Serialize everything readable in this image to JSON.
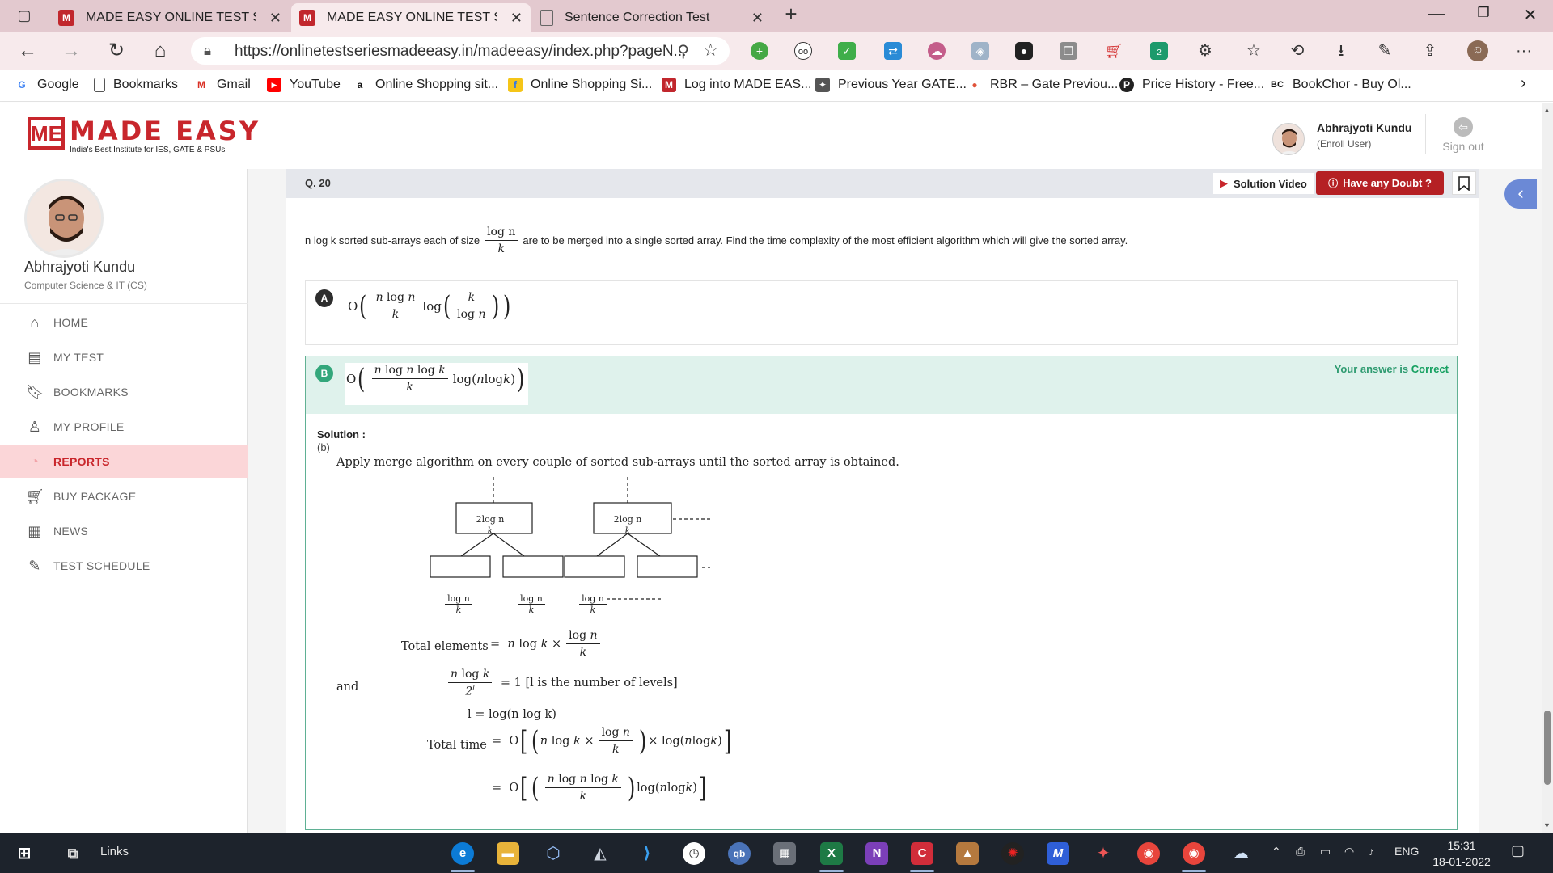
{
  "browser": {
    "tabs": [
      {
        "title": "MADE EASY ONLINE TEST SERIES",
        "active": false
      },
      {
        "title": "MADE EASY ONLINE TEST SERIES",
        "active": true
      },
      {
        "title": "Sentence Correction Test",
        "active": false
      }
    ],
    "url": "https://onlinetestseriesmadeeasy.in/madeeasy/index.php?pageN...",
    "bookmarks": [
      "Google",
      "Bookmarks",
      "Gmail",
      "YouTube",
      "Online Shopping sit...",
      "Online Shopping Si...",
      "Log into MADE EAS...",
      "Previous Year GATE...",
      "RBR – Gate Previou...",
      "Price History - Free...",
      "BookChor - Buy Ol..."
    ],
    "extension_badge": "2"
  },
  "site": {
    "logo_word": "MADE EASY",
    "logo_mark": "ME",
    "tagline": "India's Best Institute for IES, GATE & PSUs",
    "user_name": "Abhrajyoti Kundu",
    "user_role": "(Enroll User)",
    "signout": "Sign out"
  },
  "sidebar": {
    "name": "Abhrajyoti Kundu",
    "branch": "Computer Science & IT (CS)",
    "items": [
      {
        "label": "HOME",
        "icon": "home-icon",
        "active": false
      },
      {
        "label": "MY TEST",
        "icon": "test-icon",
        "active": false
      },
      {
        "label": "BOOKMARKS",
        "icon": "bookmark-icon",
        "active": false
      },
      {
        "label": "MY PROFILE",
        "icon": "profile-icon",
        "active": false
      },
      {
        "label": "REPORTS",
        "icon": "pie-chart-icon",
        "active": true
      },
      {
        "label": "BUY PACKAGE",
        "icon": "cart-icon",
        "active": false
      },
      {
        "label": "NEWS",
        "icon": "news-icon",
        "active": false
      },
      {
        "label": "TEST SCHEDULE",
        "icon": "schedule-icon",
        "active": false
      }
    ]
  },
  "question": {
    "number": "Q. 20",
    "solution_video": "Solution Video",
    "doubt_button": "Have any Doubt ?",
    "text_before": "n log k sorted sub-arrays each of size",
    "frac_num": "log n",
    "frac_den": "k",
    "text_after": "are to be merged into a single sorted array. Find the time complexity of the most efficient algorithm which will give the sorted array.",
    "options": [
      {
        "label": "A",
        "expr": "O( (n log n / k) log( k / log n ) )"
      },
      {
        "label": "B",
        "expr": "O( (n log n log k / k) log(n log k) )"
      }
    ],
    "answer_note_prefix": "Your answer is",
    "answer_note_status": "Correct"
  },
  "solution": {
    "heading": "Solution :",
    "answer": "(b)",
    "intro": "Apply merge algorithm on every couple of sorted sub-arrays until the sorted array is obtained.",
    "node_top": "2log n",
    "node_den": "k",
    "leaf_num": "log n",
    "leaf_den": "k",
    "eq_total_elements_label": "Total elements",
    "eq_and": "and",
    "eq_levels_note": "= 1 [l is the number of levels]",
    "eq_l": "l = log(n log k)",
    "eq_total_time_label": "Total time"
  },
  "taskbar": {
    "links": "Links",
    "language": "ENG",
    "time": "15:31",
    "date": "18-01-2022"
  },
  "colors": {
    "brand_red": "#c8262c",
    "correct_green": "#33a77b",
    "sidebar_active_bg": "#fbd6d8"
  }
}
